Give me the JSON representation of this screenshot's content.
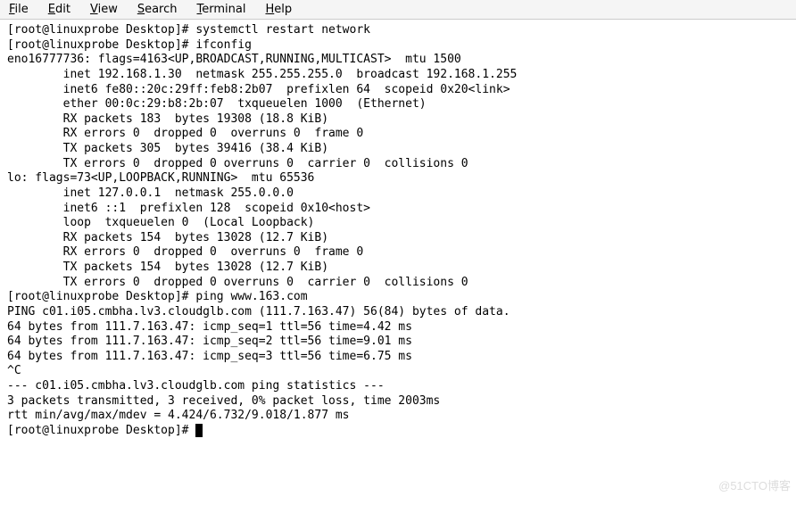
{
  "menubar": {
    "items": [
      {
        "label": "File",
        "accel": "F"
      },
      {
        "label": "Edit",
        "accel": "E"
      },
      {
        "label": "View",
        "accel": "V"
      },
      {
        "label": "Search",
        "accel": "S"
      },
      {
        "label": "Terminal",
        "accel": "T"
      },
      {
        "label": "Help",
        "accel": "H"
      }
    ]
  },
  "terminal": {
    "lines": [
      "[root@linuxprobe Desktop]# systemctl restart network",
      "[root@linuxprobe Desktop]# ifconfig",
      "eno16777736: flags=4163<UP,BROADCAST,RUNNING,MULTICAST>  mtu 1500",
      "        inet 192.168.1.30  netmask 255.255.255.0  broadcast 192.168.1.255",
      "        inet6 fe80::20c:29ff:feb8:2b07  prefixlen 64  scopeid 0x20<link>",
      "        ether 00:0c:29:b8:2b:07  txqueuelen 1000  (Ethernet)",
      "        RX packets 183  bytes 19308 (18.8 KiB)",
      "        RX errors 0  dropped 0  overruns 0  frame 0",
      "        TX packets 305  bytes 39416 (38.4 KiB)",
      "        TX errors 0  dropped 0 overruns 0  carrier 0  collisions 0",
      "",
      "lo: flags=73<UP,LOOPBACK,RUNNING>  mtu 65536",
      "        inet 127.0.0.1  netmask 255.0.0.0",
      "        inet6 ::1  prefixlen 128  scopeid 0x10<host>",
      "        loop  txqueuelen 0  (Local Loopback)",
      "        RX packets 154  bytes 13028 (12.7 KiB)",
      "        RX errors 0  dropped 0  overruns 0  frame 0",
      "        TX packets 154  bytes 13028 (12.7 KiB)",
      "        TX errors 0  dropped 0 overruns 0  carrier 0  collisions 0",
      "",
      "[root@linuxprobe Desktop]# ping www.163.com",
      "PING c01.i05.cmbha.lv3.cloudglb.com (111.7.163.47) 56(84) bytes of data.",
      "64 bytes from 111.7.163.47: icmp_seq=1 ttl=56 time=4.42 ms",
      "64 bytes from 111.7.163.47: icmp_seq=2 ttl=56 time=9.01 ms",
      "64 bytes from 111.7.163.47: icmp_seq=3 ttl=56 time=6.75 ms",
      "^C",
      "--- c01.i05.cmbha.lv3.cloudglb.com ping statistics ---",
      "3 packets transmitted, 3 received, 0% packet loss, time 2003ms",
      "rtt min/avg/max/mdev = 4.424/6.732/9.018/1.877 ms",
      "[root@linuxprobe Desktop]# "
    ]
  },
  "watermark": "@51CTO博客"
}
